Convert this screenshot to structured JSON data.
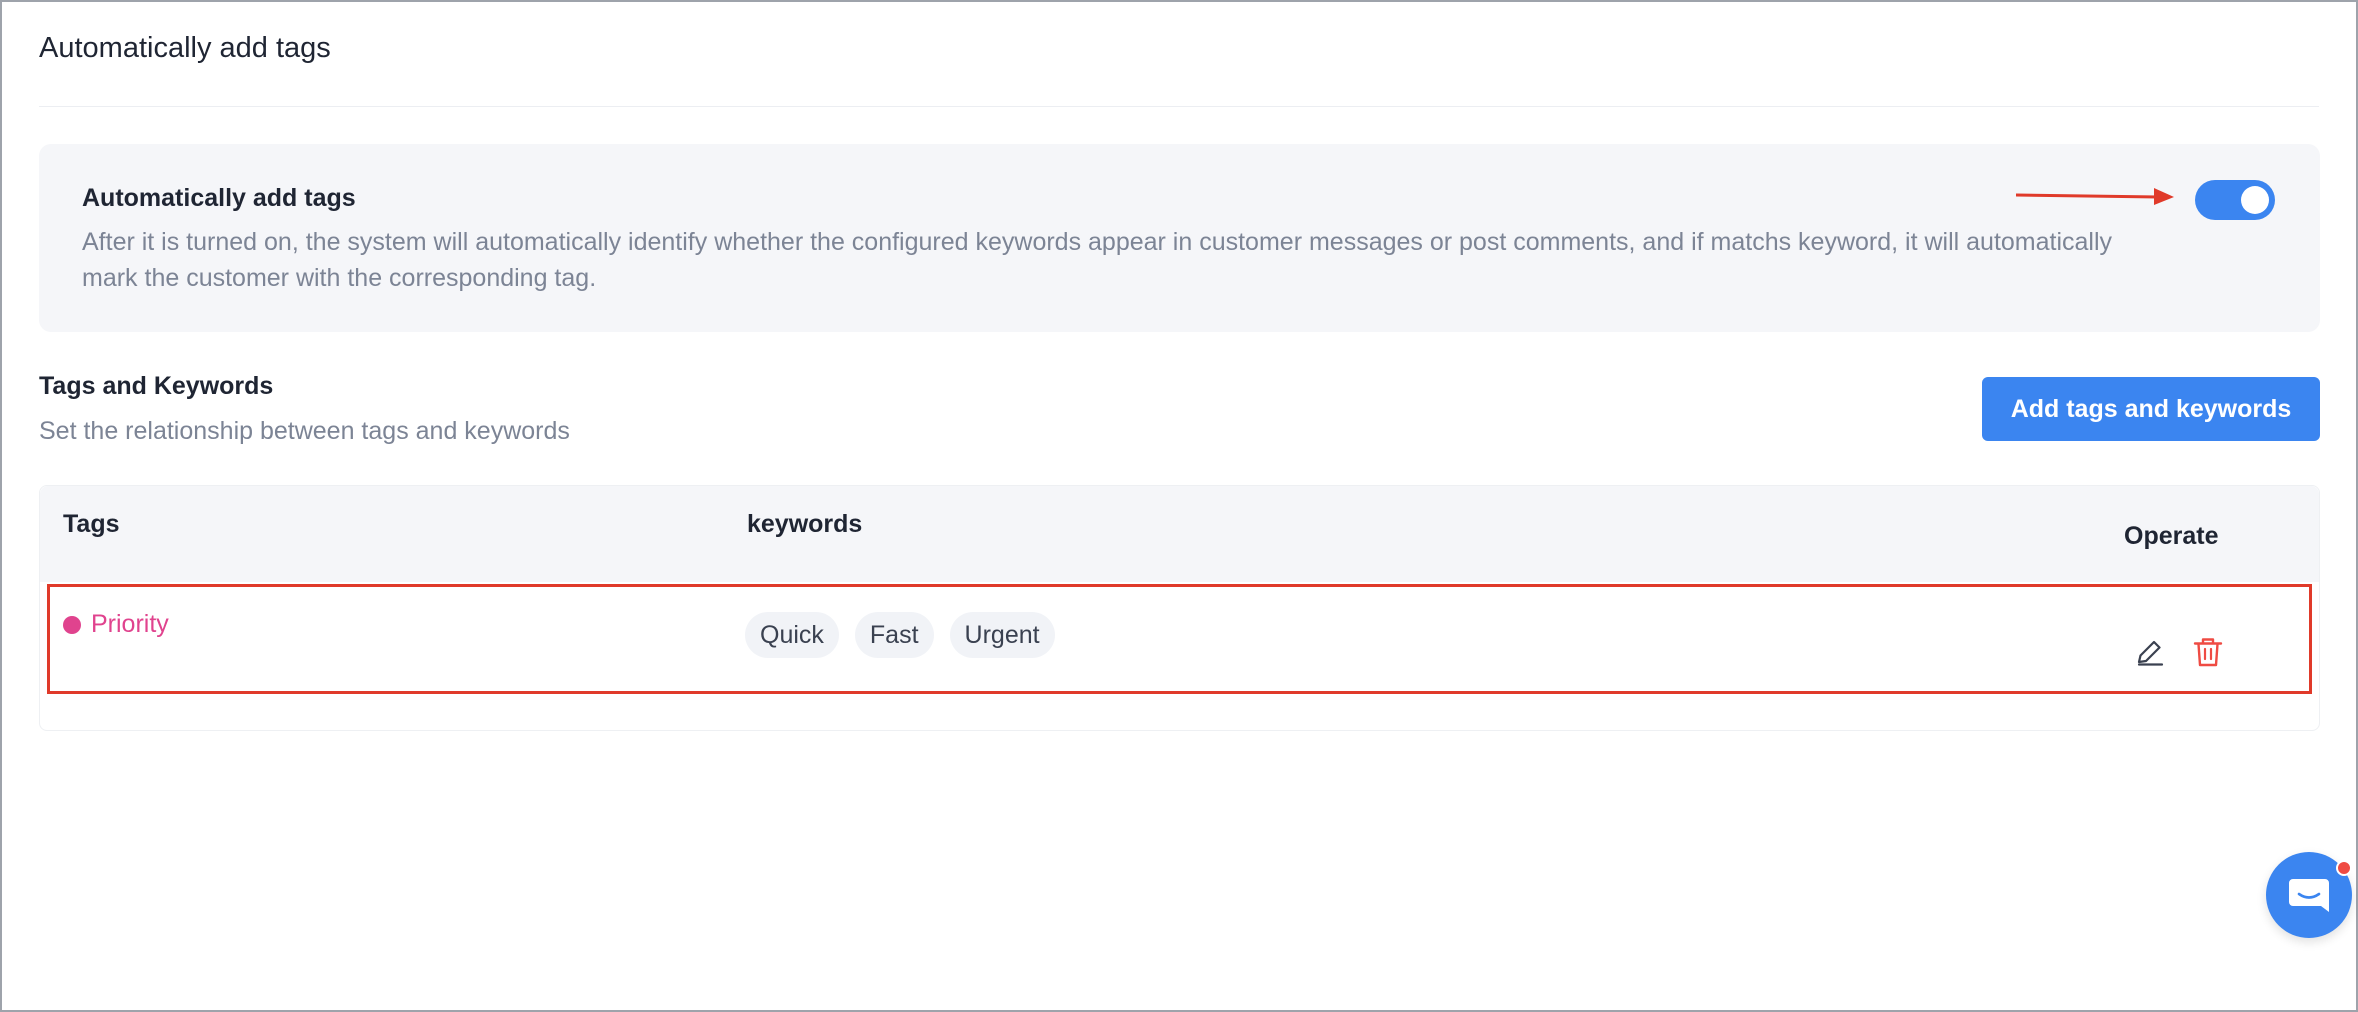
{
  "page": {
    "title": "Automatically add tags"
  },
  "auto_card": {
    "title": "Automatically add tags",
    "description": "After it is turned on, the system will automatically identify whether the configured keywords appear in customer messages or post comments, and if matchs keyword, it will automatically mark the customer with the corresponding tag.",
    "toggle_on": true
  },
  "section": {
    "title": "Tags and Keywords",
    "subtitle": "Set the relationship between tags and keywords",
    "add_button_label": "Add tags and keywords"
  },
  "table": {
    "columns": [
      "Tags",
      "keywords",
      "Operate"
    ],
    "rows": [
      {
        "tag": "Priority",
        "tag_color": "#e0438e",
        "keywords": [
          "Quick",
          "Fast",
          "Urgent"
        ],
        "actions": [
          "edit-icon",
          "trash-icon"
        ]
      }
    ]
  },
  "colors": {
    "accent": "#3b85f0",
    "annotation": "#e03a2a",
    "danger": "#ef4b43"
  },
  "chat_widget": {
    "icon": "chat-icon",
    "has_notification": true
  }
}
